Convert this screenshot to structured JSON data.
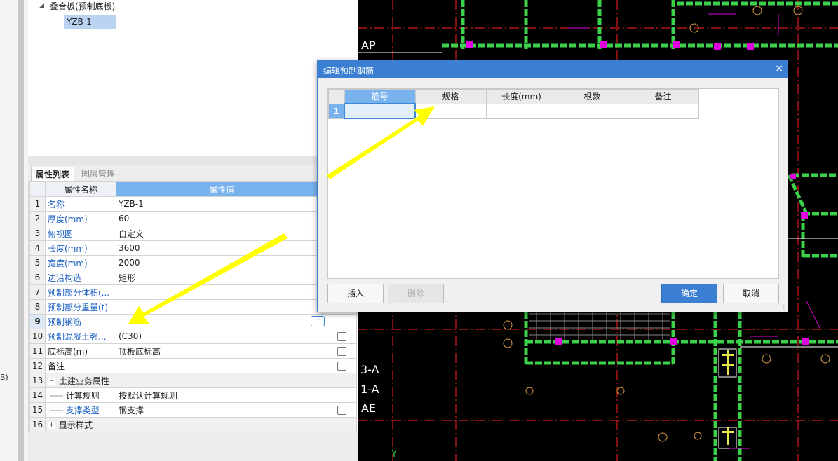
{
  "left_strip": {
    "fragment": "B)"
  },
  "tree": {
    "parent_label": "叠合板(预制底板)",
    "child_label": "YZB-1"
  },
  "property_panel": {
    "tabs": [
      "属性列表",
      "图层管理"
    ],
    "header": {
      "name_col": "属性名称",
      "value_col": "属性值"
    },
    "rows": [
      {
        "num": "1",
        "name": "名称",
        "value": "YZB-1"
      },
      {
        "num": "2",
        "name": "厚度(mm)",
        "value": "60"
      },
      {
        "num": "3",
        "name": "俯视图",
        "value": "自定义"
      },
      {
        "num": "4",
        "name": "长度(mm)",
        "value": "3600"
      },
      {
        "num": "5",
        "name": "宽度(mm)",
        "value": "2000"
      },
      {
        "num": "6",
        "name": "边沿构造",
        "value": "矩形"
      },
      {
        "num": "7",
        "name": "预制部分体积(...",
        "value": ""
      },
      {
        "num": "8",
        "name": "预制部分重量(t)",
        "value": ""
      },
      {
        "num": "9",
        "name": "预制钢筋",
        "value": "",
        "button": "···"
      },
      {
        "num": "10",
        "name": "预制混凝土强...",
        "value": "(C30)"
      },
      {
        "num": "11",
        "name": "底标高(m)",
        "value": "顶板底标高"
      },
      {
        "num": "12",
        "name": "备注",
        "value": ""
      },
      {
        "num": "13",
        "name": "土建业务属性",
        "expander": "−"
      },
      {
        "num": "14",
        "name": "计算规则",
        "value": "按默认计算规则"
      },
      {
        "num": "15",
        "name": "支撑类型",
        "value": "钢支撑"
      },
      {
        "num": "16",
        "name": "显示样式",
        "expander": "+"
      }
    ]
  },
  "dialog": {
    "title": "编辑预制钢筋",
    "close": "×",
    "columns": [
      "筋号",
      "规格",
      "长度(mm)",
      "根数",
      "备注"
    ],
    "row_number": "1",
    "buttons": {
      "insert": "插入",
      "delete": "删除",
      "ok": "确定",
      "cancel": "取消"
    },
    "grip": "⠿"
  },
  "cad": {
    "axis_labels": [
      "AP",
      "3-A",
      "1-A",
      "AE",
      "Y"
    ]
  },
  "colors": {
    "accent": "#3b7fd3",
    "header_blue": "#78b3ee",
    "cad_green": "#3bd14a",
    "cad_magenta": "#e000e0",
    "cad_red": "#ff2020",
    "arrow_yellow": "#ffff00"
  }
}
